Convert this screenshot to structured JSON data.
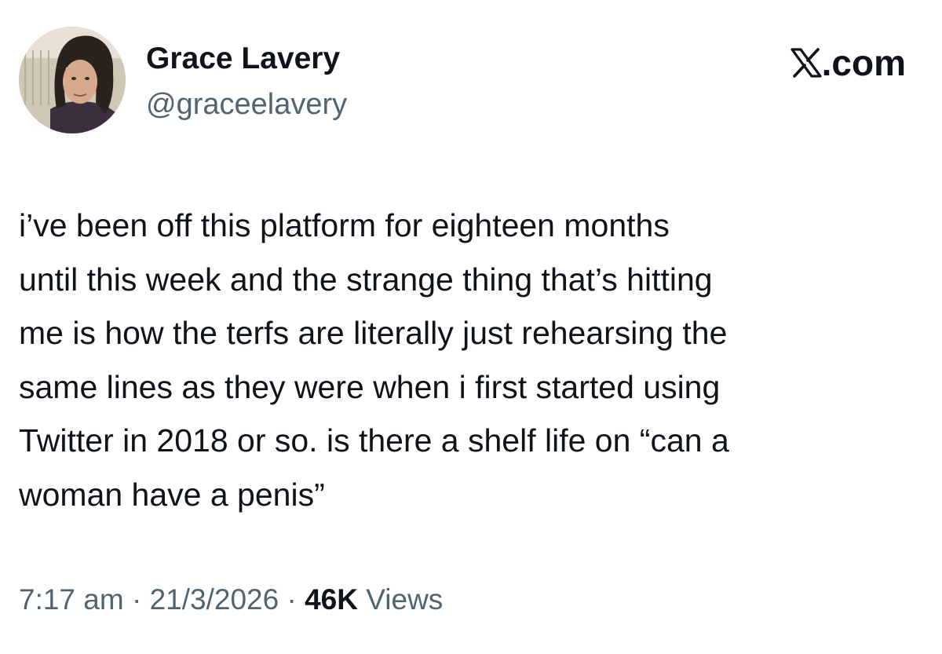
{
  "author": {
    "display_name": "Grace Lavery",
    "handle": "@graceelavery"
  },
  "brand": {
    "icon": "x-logo-icon",
    "domain": ".com"
  },
  "tweet": {
    "lines": [
      "i’ve been off this platform for eighteen months",
      "until this week and the strange thing that’s hitting",
      "me is how the terfs are literally just rehearsing the",
      "same lines as they were when i first started using",
      "Twitter in 2018 or so. is there a shelf life on “can a",
      "woman have a penis”"
    ]
  },
  "meta": {
    "time": "7:17 am",
    "separator": "·",
    "date": "21/3/2026",
    "views_count": "46K",
    "views_label": "Views"
  },
  "colors": {
    "text": "#0f1419",
    "secondary_text": "#536471",
    "background": "#ffffff"
  }
}
